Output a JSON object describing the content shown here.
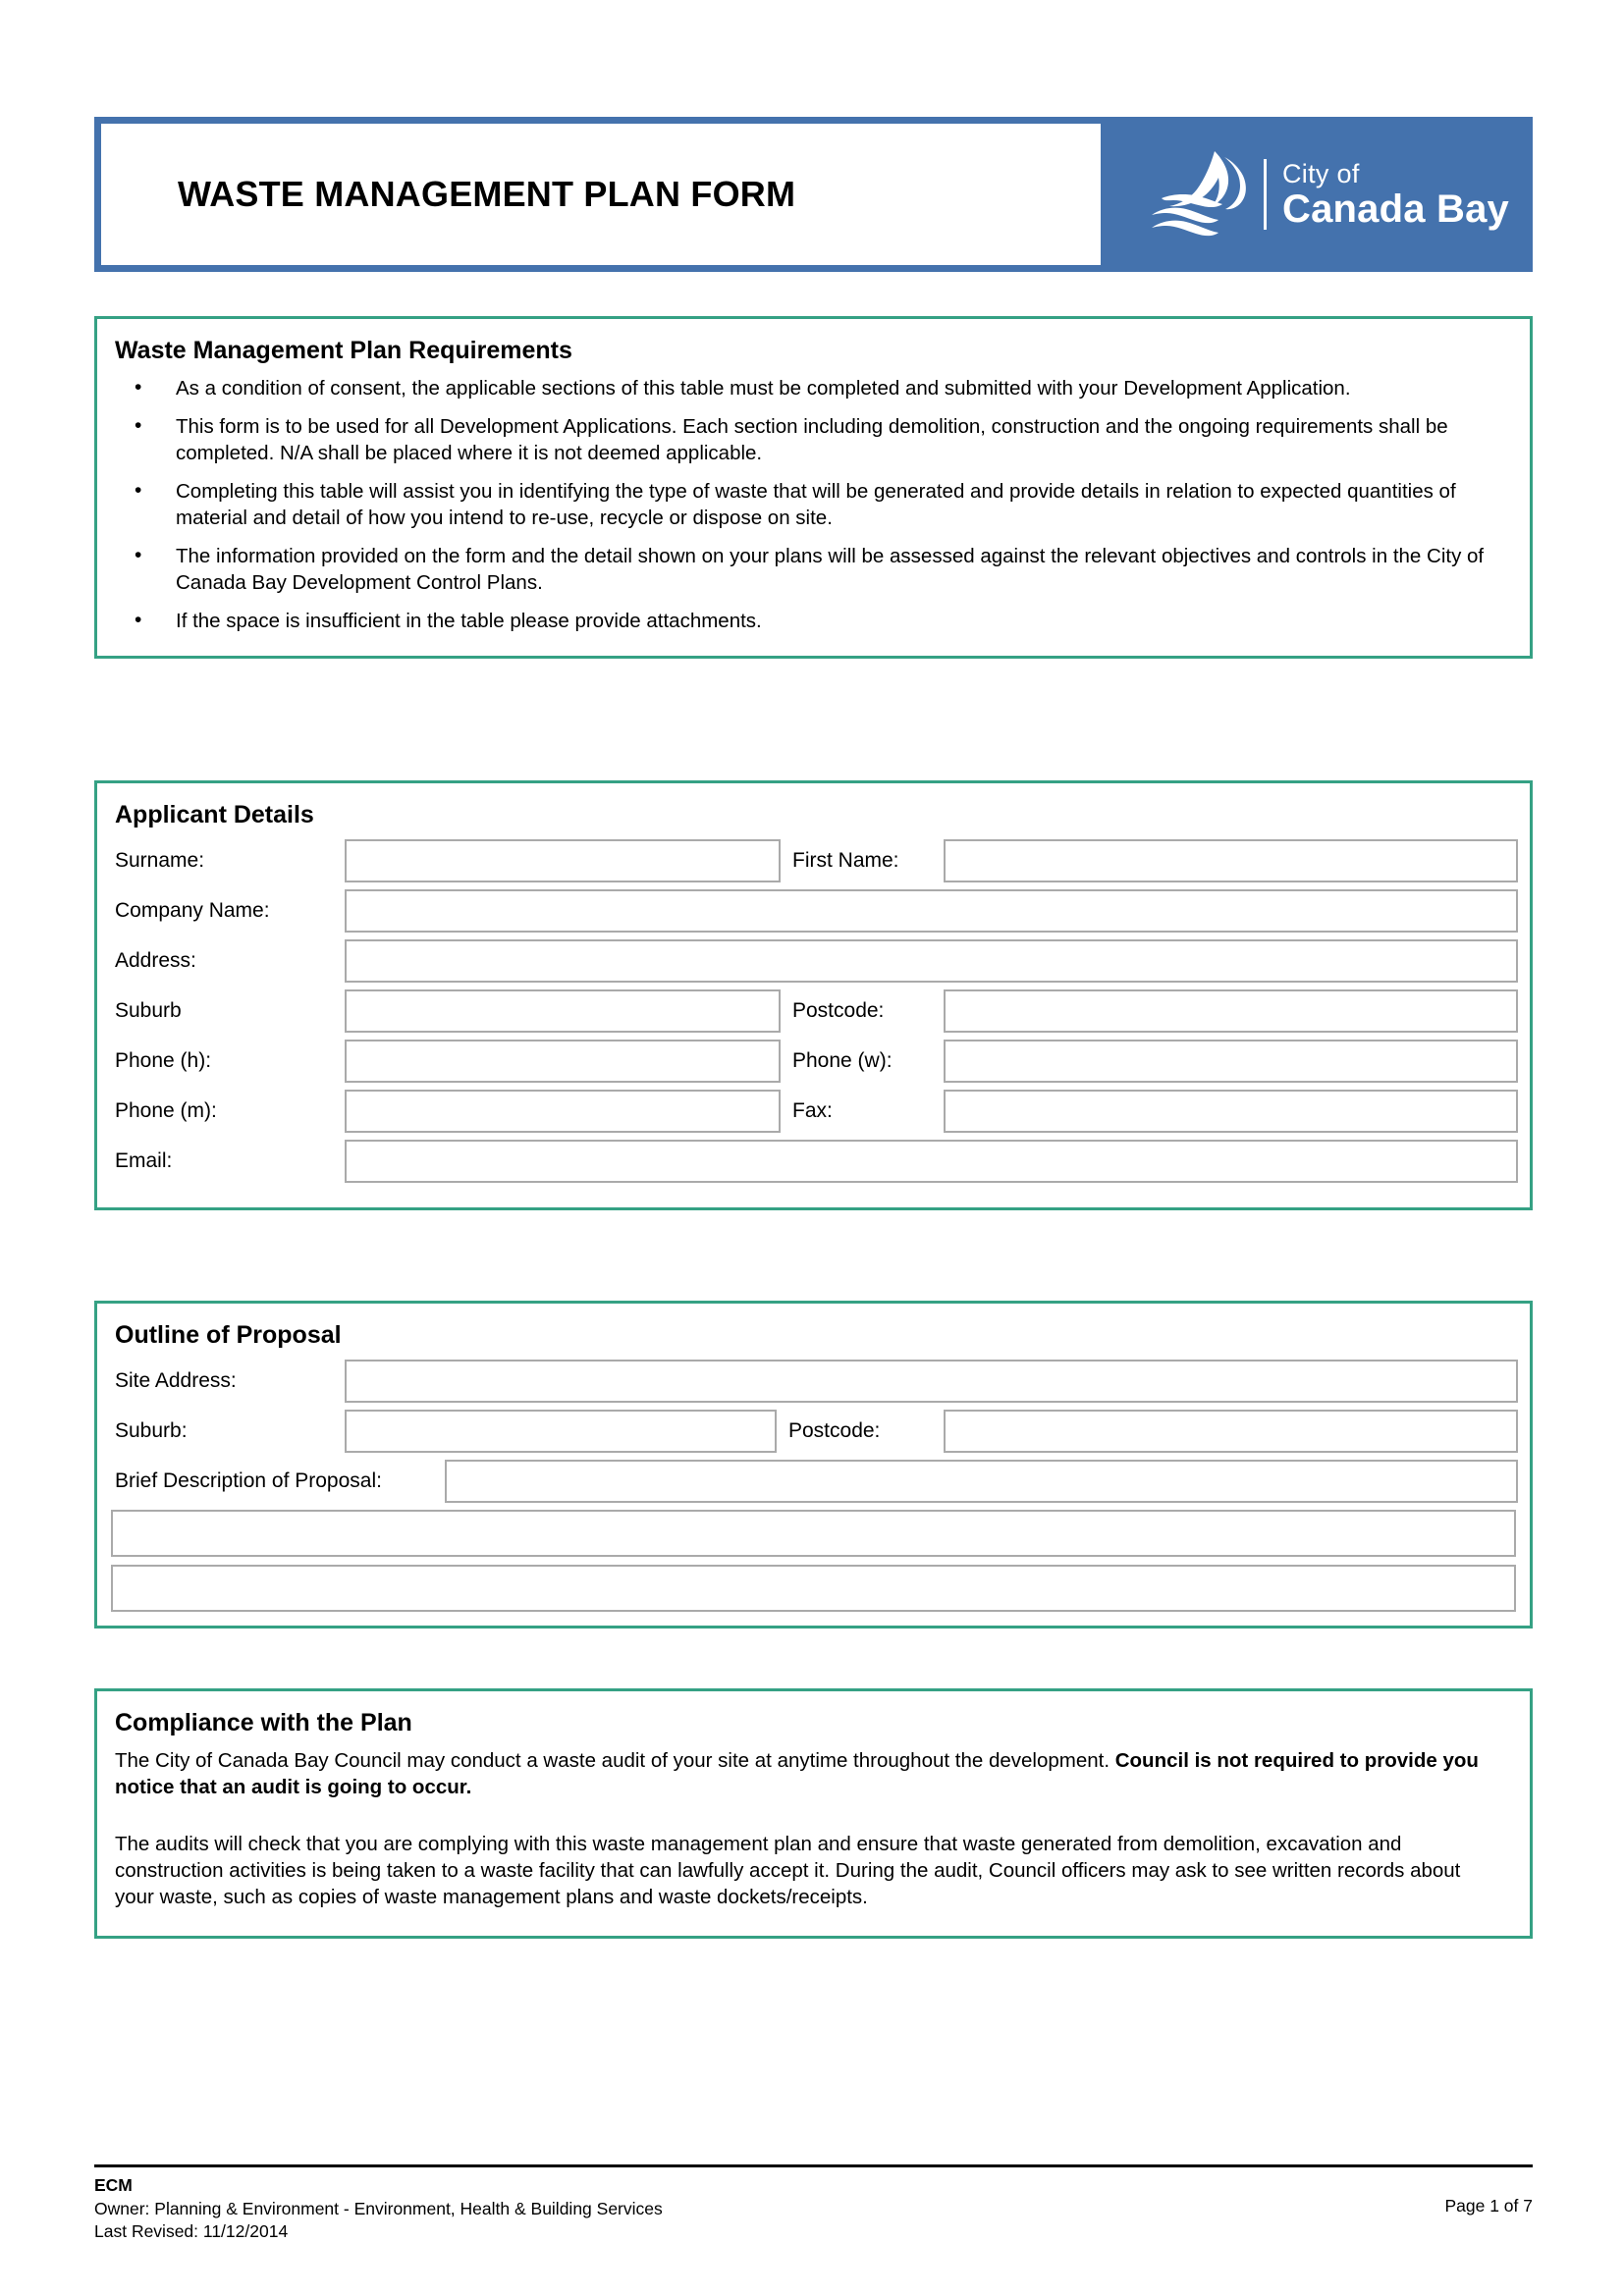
{
  "header": {
    "title": "WASTE MANAGEMENT PLAN FORM",
    "logo": {
      "icon": "sailboat-waves-logo",
      "line1": "City of",
      "line2": "Canada Bay"
    },
    "colors": {
      "brand_blue": "#4472ad",
      "panel_green": "#35a184",
      "field_border": "#aaaaaa"
    }
  },
  "requirements": {
    "heading": "Waste Management Plan Requirements",
    "bullet_glyph": "•",
    "items": [
      "As a condition of consent, the applicable sections of this table must be completed and submitted with your Development Application.",
      "This form is to be used for all Development Applications.  Each section including demolition, construction and the ongoing requirements shall be completed.  N/A shall be placed where it is not deemed applicable.",
      "Completing this table will assist you in identifying the type of waste that will be generated and provide details in relation to expected quantities of material and detail of how you intend to re-use, recycle or dispose on site.",
      "The information provided on the form and the detail shown on your plans will be assessed against the relevant objectives and controls in the City of Canada Bay Development Control Plans.",
      "If the space is insufficient in the table please provide attachments."
    ]
  },
  "applicant": {
    "heading": "Applicant Details",
    "fields": {
      "surname_label": "Surname:",
      "surname_value": "",
      "first_name_label": "First Name:",
      "first_name_value": "",
      "company_label": "Company Name:",
      "company_value": "",
      "address_label": "Address:",
      "address_value": "",
      "suburb_label": "Suburb",
      "suburb_value": "",
      "postcode_label": "Postcode:",
      "postcode_value": "",
      "phone_h_label": "Phone (h):",
      "phone_h_value": "",
      "phone_w_label": "Phone (w):",
      "phone_w_value": "",
      "phone_m_label": "Phone (m):",
      "phone_m_value": "",
      "fax_label": "Fax:",
      "fax_value": "",
      "email_label": "Email:",
      "email_value": ""
    }
  },
  "proposal": {
    "heading": "Outline of Proposal",
    "fields": {
      "site_address_label": "Site Address:",
      "site_address_value": "",
      "suburb_label": "Suburb:",
      "suburb_value": "",
      "postcode_label": "Postcode:",
      "postcode_value": "",
      "brief_label": "Brief Description of Proposal:",
      "brief_value": "",
      "brief_line2_value": "",
      "brief_line3_value": ""
    }
  },
  "compliance": {
    "heading": "Compliance with the Plan",
    "para1_normal": "The City of Canada Bay Council may conduct a waste audit of your site at anytime throughout the development. ",
    "para1_bold": "Council is not required to provide you notice that an audit is going to occur.",
    "para2": "The audits will check that you are complying with this waste management plan and ensure that waste generated from demolition, excavation and construction activities is being taken to a waste facility that can lawfully accept it. During the audit, Council officers may ask to see written records about your waste, such as copies of waste management plans and waste dockets/receipts."
  },
  "footer": {
    "ecm": "ECM",
    "owner": "Owner: Planning & Environment - Environment, Health & Building Services",
    "revised": "Last Revised: 11/12/2014",
    "page": "Page 1 of 7"
  }
}
